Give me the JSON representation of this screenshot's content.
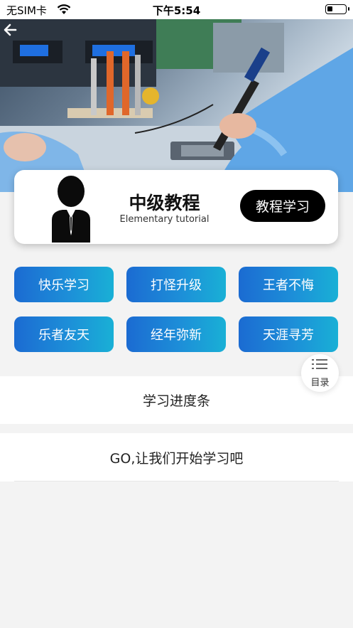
{
  "status_bar": {
    "carrier": "无SIM卡",
    "time": "下午5:54"
  },
  "hero": {
    "back_icon": "arrow-left-icon"
  },
  "course_card": {
    "title": "中级教程",
    "subtitle": "Elementary tutorial",
    "button_label": "教程学习",
    "avatar_icon": "businessman-avatar"
  },
  "grid_buttons": [
    {
      "label": "快乐学习"
    },
    {
      "label": "打怪升级"
    },
    {
      "label": "王者不悔"
    },
    {
      "label": "乐者友天"
    },
    {
      "label": "经年弥新"
    },
    {
      "label": "天涯寻芳"
    }
  ],
  "toc": {
    "label": "目录",
    "icon": "list-icon"
  },
  "sections": {
    "progress": "学习进度条",
    "start": "GO,让我们开始学习吧"
  },
  "colors": {
    "button_gradient_start": "#1b6bd2",
    "button_gradient_end": "#19b0d6",
    "primary_button": "#000000",
    "page_background": "#f3f3f3"
  }
}
